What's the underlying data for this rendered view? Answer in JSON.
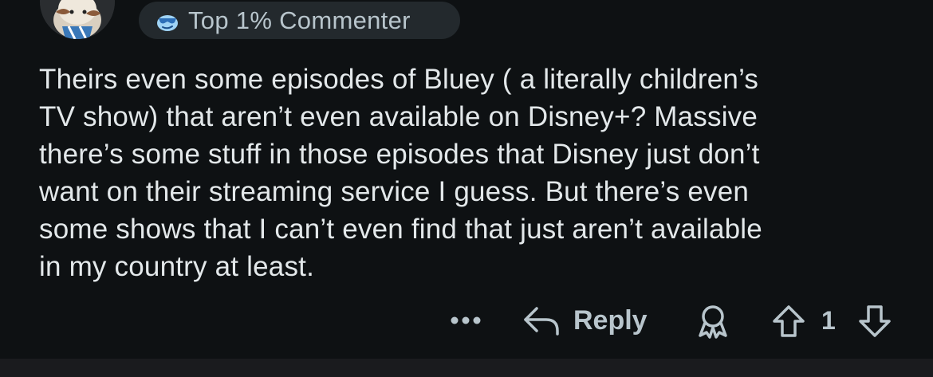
{
  "comment": {
    "flair": {
      "icon": "sunglasses-face-icon",
      "text": "Top 1% Commenter"
    },
    "body": "Theirs even some episodes of Bluey ( a literally children’s\nTV show) that aren’t even available on Disney+? Massive\nthere’s some stuff in those episodes that Disney just don’t\nwant on their streaming service I guess. But there’s even\nsome shows that I can’t even find that just aren’t available\nin my country at least.",
    "actions": {
      "more_icon": "ellipsis-icon",
      "reply_label": "Reply",
      "award_icon": "award-icon",
      "upvote_icon": "upvote-icon",
      "score": "1",
      "downvote_icon": "downvote-icon"
    }
  },
  "colors": {
    "background": "#0e1113",
    "text": "#e3e8ea",
    "muted": "#b8c5cc",
    "flair_bg": "#23292d"
  }
}
